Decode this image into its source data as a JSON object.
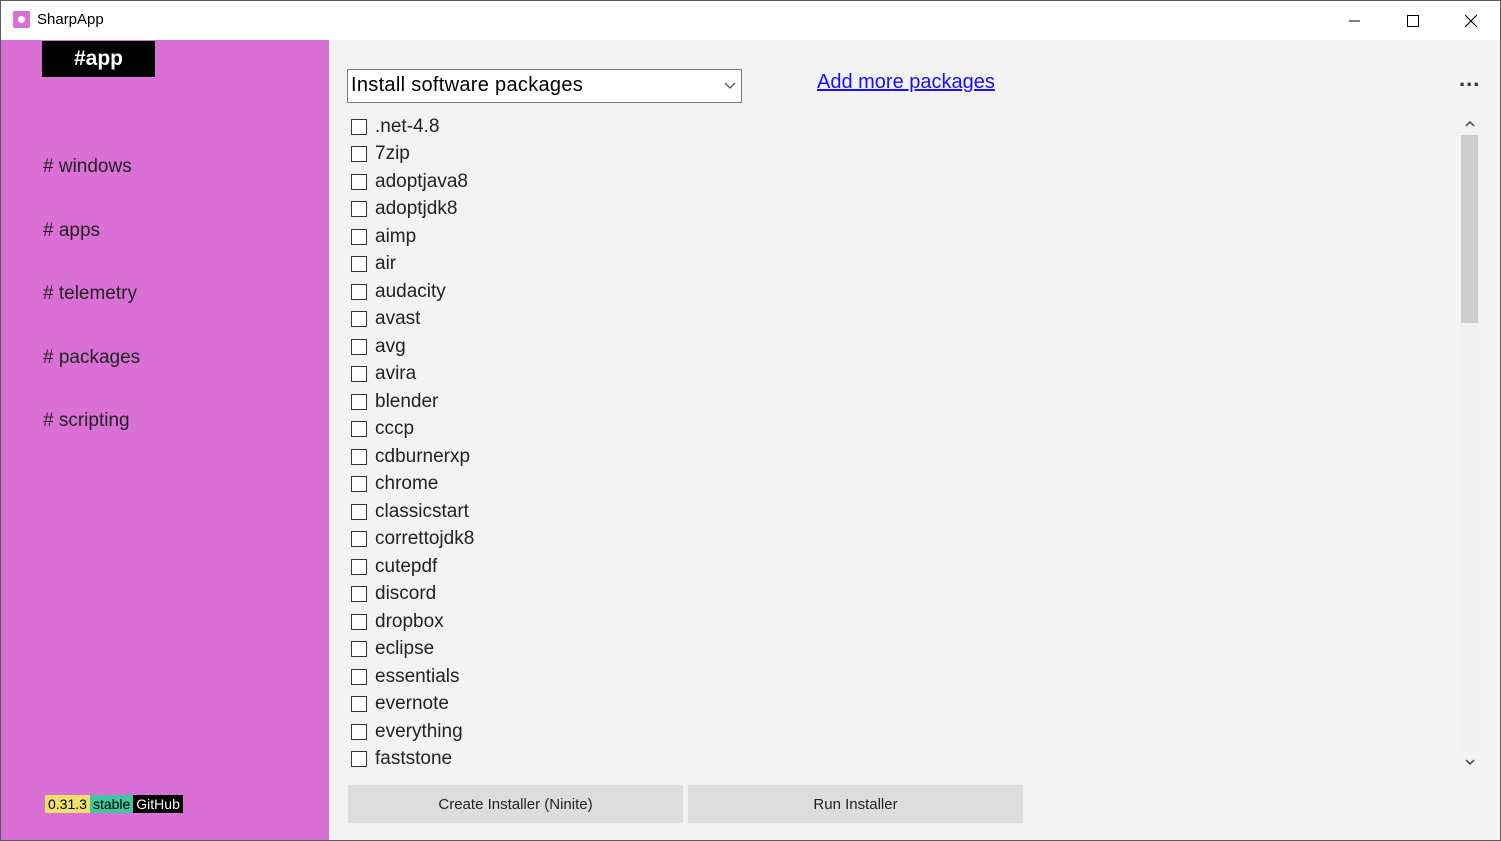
{
  "window": {
    "title": "SharpApp"
  },
  "sidebar": {
    "brand": "#app",
    "items": [
      {
        "label": "# windows"
      },
      {
        "label": "# apps"
      },
      {
        "label": "# telemetry"
      },
      {
        "label": "# packages"
      },
      {
        "label": "# scripting"
      }
    ],
    "badges": {
      "version": "0.31.3",
      "channel": "stable",
      "github": "GitHub"
    }
  },
  "main": {
    "select": {
      "value": "Install software packages"
    },
    "link": "Add more packages",
    "more": "...",
    "packages": [
      ".net-4.8",
      "7zip",
      "adoptjava8",
      "adoptjdk8",
      "aimp",
      "air",
      "audacity",
      "avast",
      "avg",
      "avira",
      "blender",
      "cccp",
      "cdburnerxp",
      "chrome",
      "classicstart",
      "correttojdk8",
      "cutepdf",
      "discord",
      "dropbox",
      "eclipse",
      "essentials",
      "evernote",
      "everything",
      "faststone"
    ],
    "buttons": {
      "create": "Create Installer (Ninite)",
      "run": "Run Installer"
    }
  },
  "colors": {
    "sidebar": "#da70d6",
    "link": "#1a0dff",
    "badge_version": "#f0e068",
    "badge_stable": "#3ec7a0"
  },
  "icons": [
    "app-icon",
    "minimize-icon",
    "maximize-icon",
    "close-icon",
    "chevron-down-icon",
    "more-icon",
    "scroll-up-icon",
    "scroll-down-icon"
  ]
}
